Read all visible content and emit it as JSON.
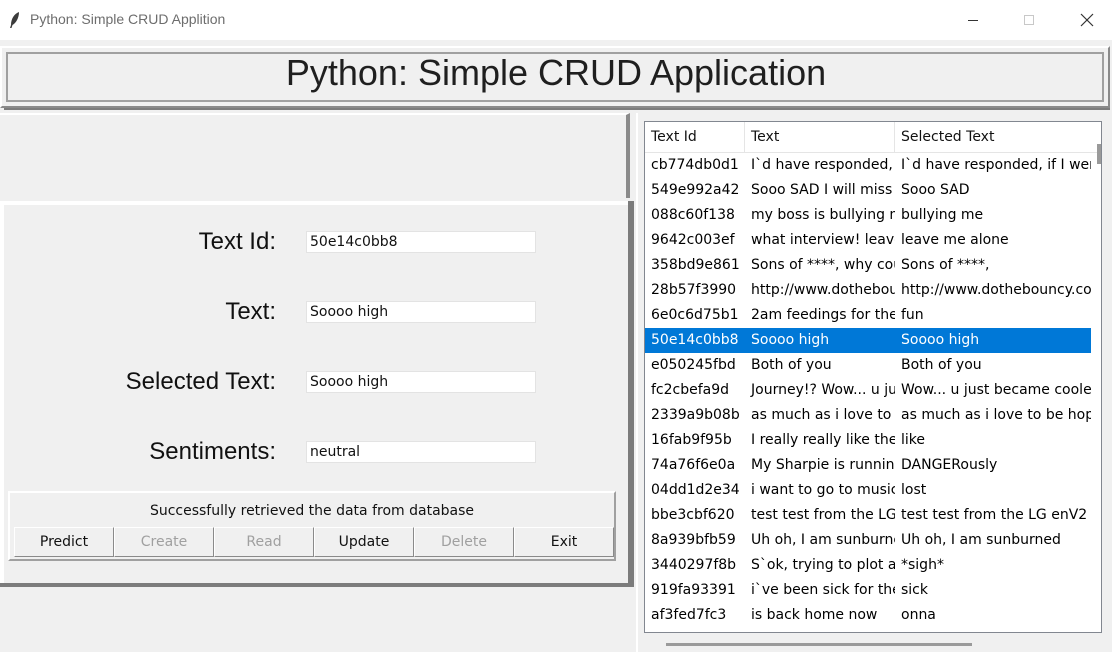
{
  "window": {
    "title": "Python: Simple CRUD Applition"
  },
  "header": {
    "title": "Python: Simple CRUD Application"
  },
  "form": {
    "text_id_label": "Text Id:",
    "text_id_value": "50e14c0bb8",
    "text_label": "Text:",
    "text_value": "Soooo high",
    "selected_text_label": "Selected Text:",
    "selected_text_value": "Soooo high",
    "sentiments_label": "Sentiments:",
    "sentiments_value": "neutral"
  },
  "status": {
    "message": "Successfully retrieved the data from database"
  },
  "buttons": {
    "predict": "Predict",
    "create": "Create",
    "read": "Read",
    "update": "Update",
    "delete": "Delete",
    "exit": "Exit"
  },
  "table": {
    "columns": [
      "Text Id",
      "Text",
      "Selected Text"
    ],
    "selected_row": 7,
    "rows": [
      [
        "cb774db0d1",
        " I`d have responded, i",
        "I`d have responded, if I were"
      ],
      [
        "549e992a42",
        " Sooo SAD I will miss",
        "Sooo SAD"
      ],
      [
        "088c60f138",
        "my boss is bullying m",
        "bullying me"
      ],
      [
        "9642c003ef",
        " what interview! leave",
        "leave me alone"
      ],
      [
        "358bd9e861",
        " Sons of ****, why cou",
        "Sons of ****,"
      ],
      [
        "28b57f3990",
        "http://www.dothebou",
        "http://www.dothebouncy.co"
      ],
      [
        "6e0c6d75b1",
        "2am feedings for the",
        "fun"
      ],
      [
        "50e14c0bb8",
        "Soooo high",
        "Soooo high"
      ],
      [
        "e050245fbd",
        " Both of you",
        "Both of you"
      ],
      [
        "fc2cbefa9d",
        " Journey!? Wow... u ju",
        "Wow... u just became cooler"
      ],
      [
        "2339a9b08b",
        " as much as i love to l",
        "as much as i love to be hope"
      ],
      [
        "16fab9f95b",
        "I really really like the s",
        "like"
      ],
      [
        "74a76f6e0a",
        "My Sharpie is running",
        "DANGERously"
      ],
      [
        "04dd1d2e34",
        "i want to go to music",
        "lost"
      ],
      [
        "bbe3cbf620",
        "test test from the LG",
        "test test from the LG enV2"
      ],
      [
        "8a939bfb59",
        "Uh oh, I am sunburne",
        "Uh oh, I am sunburned"
      ],
      [
        "3440297f8b",
        " S`ok, trying to plot al",
        "*sigh*"
      ],
      [
        "919fa93391",
        "i`ve been sick for the",
        "sick"
      ],
      [
        "af3fed7fc3",
        "is back home now",
        "onna"
      ]
    ]
  }
}
